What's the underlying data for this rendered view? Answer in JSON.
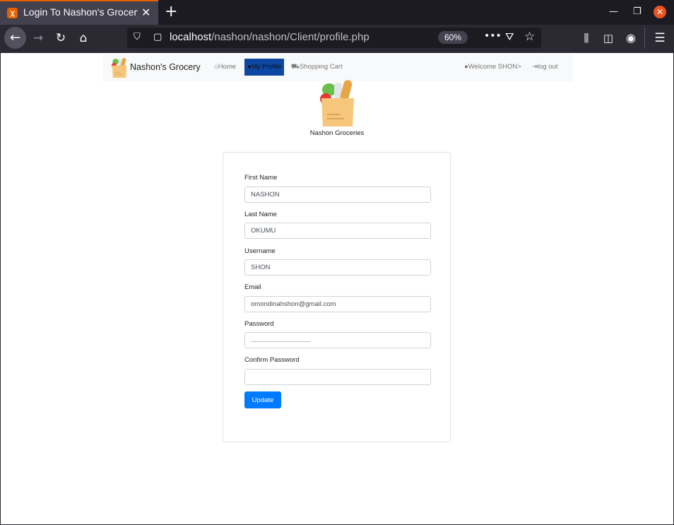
{
  "browser": {
    "tab_title": "Login To Nashon's Grocery",
    "url_host": "localhost",
    "url_path": "/nashon/nashon/Client/profile.php",
    "zoom": "60%"
  },
  "site": {
    "brand": "Nashon's Grocery",
    "nav": {
      "home": "Home",
      "profile": "My Profile",
      "cart": "Shopping Cart",
      "welcome": "Welcome SHON>",
      "logout": "log out"
    },
    "logo_caption": "Nashon Groceries"
  },
  "form": {
    "first_name_label": "First Name",
    "first_name_value": "NASHON",
    "last_name_label": "Last Name",
    "last_name_value": "OKUMU",
    "username_label": "Username",
    "username_value": "SHON",
    "email_label": "Email",
    "email_value": "omondinahshon@gmail.com",
    "password_label": "Password",
    "password_value": "................................",
    "confirm_password_label": "Confirm Password",
    "confirm_password_value": "",
    "update_label": "Update"
  },
  "colors": {
    "accent": "#007bff",
    "active_nav": "#0d47a1",
    "tab_highlight": "#e66000"
  }
}
